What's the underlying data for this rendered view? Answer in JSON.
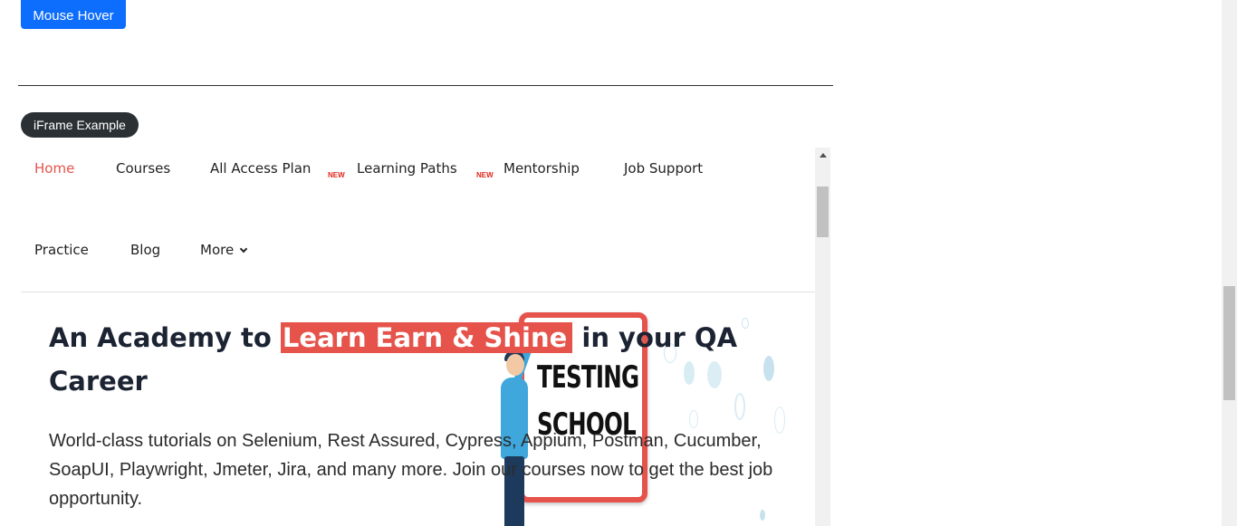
{
  "mouse_hover": {
    "label": "Mouse Hover"
  },
  "iframe_section": {
    "badge": "iFrame Example"
  },
  "iframe": {
    "nav": {
      "items": [
        {
          "label": "Home",
          "active": true
        },
        {
          "label": "Courses"
        },
        {
          "label": "All Access Plan",
          "tag": "NEW"
        },
        {
          "label": "Learning Paths",
          "tag": "NEW"
        },
        {
          "label": "Mentorship"
        },
        {
          "label": "Job Support"
        },
        {
          "label": "Practice"
        },
        {
          "label": "Blog"
        },
        {
          "label": "More"
        }
      ]
    },
    "hero": {
      "title_before": "An Academy to ",
      "title_highlight": "Learn Earn & Shine",
      "title_after": " in your QA Career",
      "description": "World-class tutorials on Selenium, Rest Assured, Cypress, Appium, Postman, Cucumber, SoapUI, Playwright, Jmeter, Jira, and many more. Join our courses now to get the best job opportunity.",
      "illustration_text": [
        "TESTING",
        "SCHOOL"
      ]
    }
  },
  "colors": {
    "primary_button": "#0d6efd",
    "accent": "#e5534b",
    "badge_bg": "#2b3034",
    "heading": "#1c2333"
  },
  "icons": {
    "more_dropdown": "chevron-down-icon",
    "scroll_up": "arrow-up-icon"
  }
}
